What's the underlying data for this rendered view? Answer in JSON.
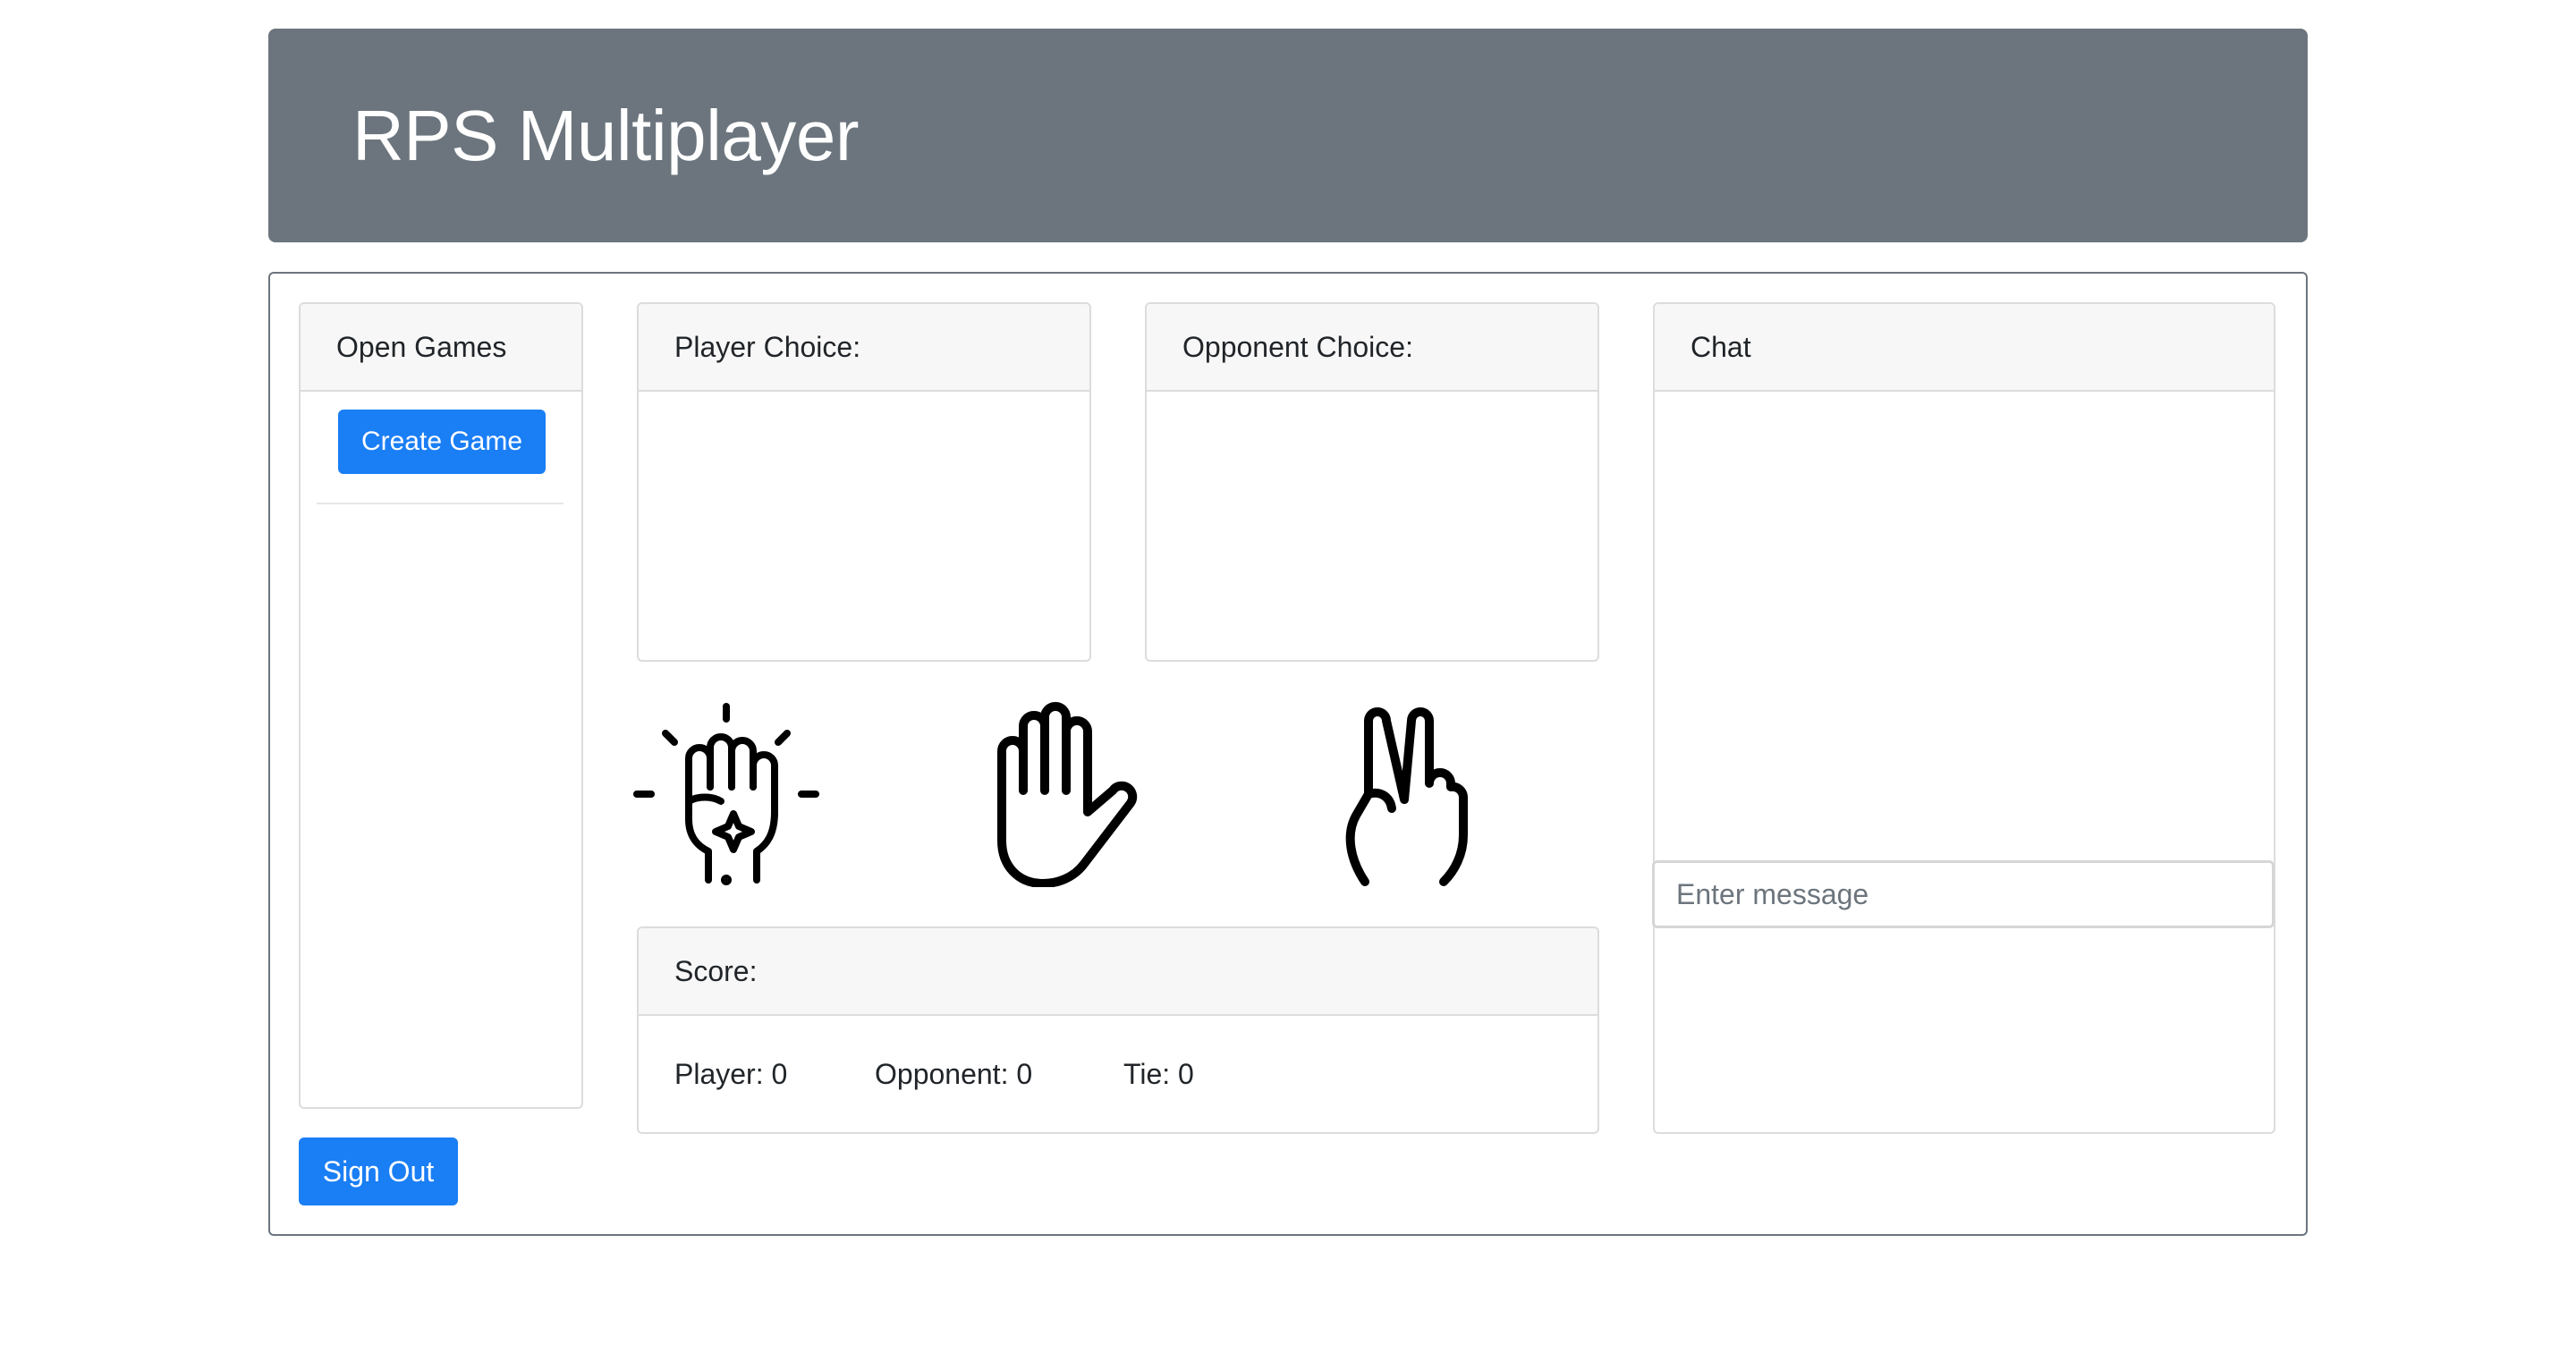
{
  "header": {
    "title": "RPS Multiplayer"
  },
  "open_games": {
    "title": "Open Games",
    "create_button": "Create Game"
  },
  "player_choice": {
    "title": "Player Choice:"
  },
  "opponent_choice": {
    "title": "Opponent Choice:"
  },
  "choices": {
    "rock": "rock-fist-icon",
    "paper": "paper-hand-icon",
    "scissors": "scissors-peace-icon"
  },
  "score": {
    "title": "Score:",
    "player": "Player: 0",
    "opponent": "Opponent: 0",
    "tie": "Tie: 0"
  },
  "chat": {
    "title": "Chat",
    "placeholder": "Enter message"
  },
  "sign_out": "Sign Out",
  "colors": {
    "primary": "#1a7ef5",
    "header_bg": "#6c757d"
  }
}
